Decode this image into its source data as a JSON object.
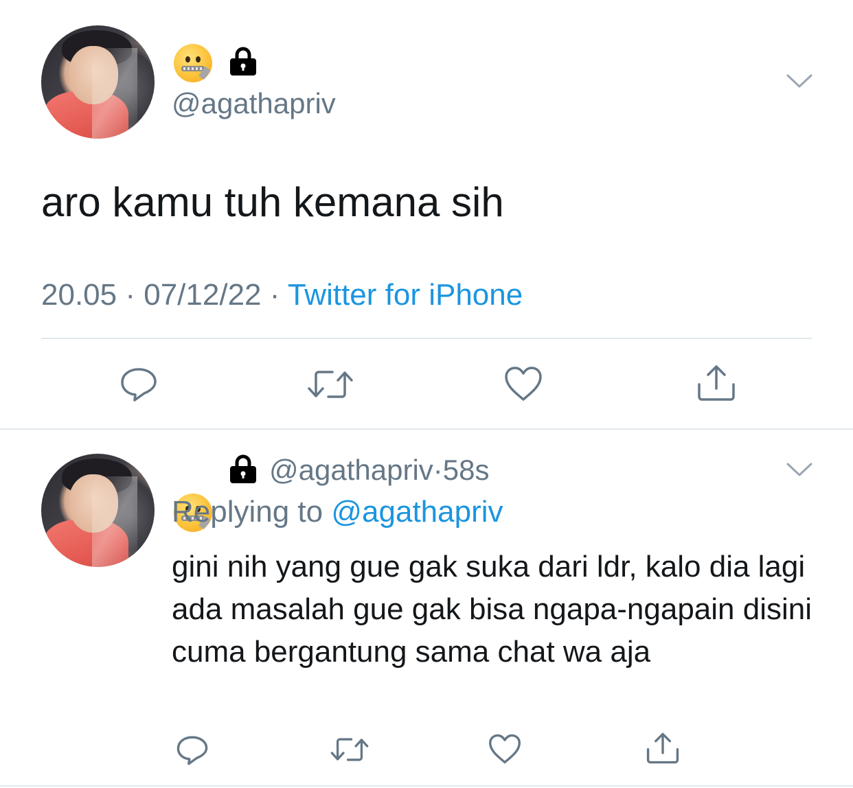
{
  "main_tweet": {
    "display_name_emoji": "zipper-mouth-face",
    "locked_icon": "lock-icon",
    "handle": "@agathapriv",
    "text": "aro kamu tuh kemana sih",
    "time": "20.05",
    "date": "07/12/22",
    "separator": "·",
    "client": "Twitter for iPhone"
  },
  "reply_tweet": {
    "display_name_emoji": "zipper-mouth-face",
    "locked_icon": "lock-icon",
    "handle": "@agathapriv",
    "separator": "·",
    "age": "58s",
    "replying_prefix": "Replying to",
    "replying_handle": "@agathapriv",
    "text": "gini nih yang gue gak suka dari ldr, kalo dia lagi ada masalah gue gak bisa ngapa-ngapain disini cuma bergantung sama chat wa aja"
  },
  "actions": [
    "reply-icon",
    "retweet-icon",
    "like-icon",
    "share-icon"
  ],
  "colors": {
    "link": "#1b95e0",
    "muted": "#657786",
    "text": "#14171a",
    "divider": "#e1e8ed"
  }
}
